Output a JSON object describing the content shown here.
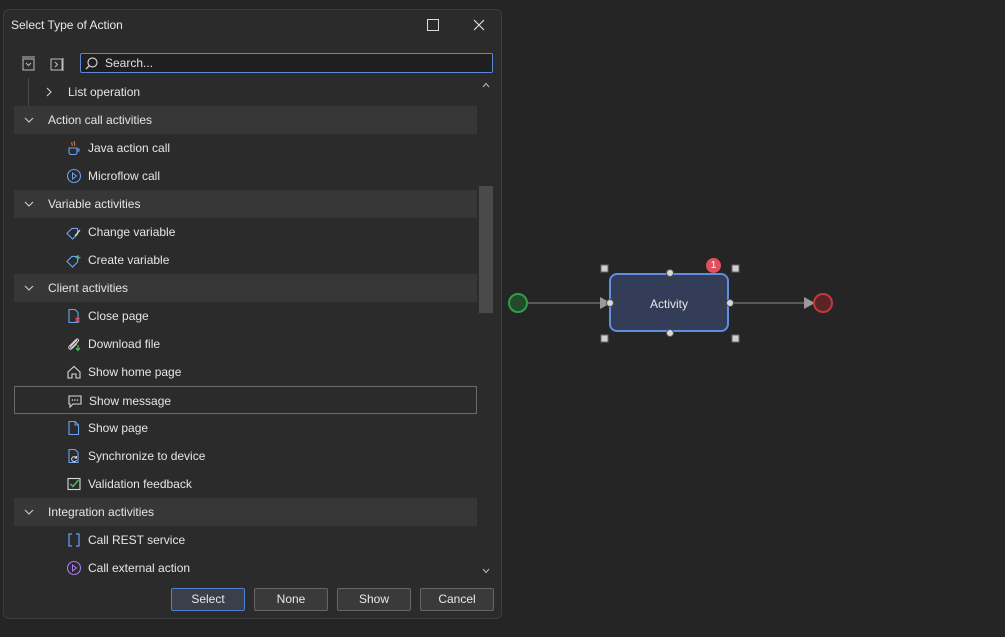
{
  "dialog": {
    "title": "Select Type of Action",
    "search": {
      "placeholder": "Search...",
      "value": ""
    },
    "list": [
      {
        "kind": "sub",
        "label": "List operation",
        "icon": "chevron-right-icon"
      },
      {
        "kind": "category",
        "label": "Action call activities"
      },
      {
        "kind": "item",
        "label": "Java action call",
        "icon": "java-icon"
      },
      {
        "kind": "item",
        "label": "Microflow call",
        "icon": "play-circle-icon"
      },
      {
        "kind": "category",
        "label": "Variable activities"
      },
      {
        "kind": "item",
        "label": "Change variable",
        "icon": "tag-edit-icon"
      },
      {
        "kind": "item",
        "label": "Create variable",
        "icon": "tag-add-icon"
      },
      {
        "kind": "category",
        "label": "Client activities"
      },
      {
        "kind": "item",
        "label": "Close page",
        "icon": "close-page-icon"
      },
      {
        "kind": "item",
        "label": "Download file",
        "icon": "download-file-icon"
      },
      {
        "kind": "item",
        "label": "Show home page",
        "icon": "home-icon"
      },
      {
        "kind": "item",
        "label": "Show message",
        "icon": "message-icon",
        "hover": true
      },
      {
        "kind": "item",
        "label": "Show page",
        "icon": "page-icon"
      },
      {
        "kind": "item",
        "label": "Synchronize to device",
        "icon": "sync-page-icon"
      },
      {
        "kind": "item",
        "label": "Validation feedback",
        "icon": "checkbox-icon"
      },
      {
        "kind": "category",
        "label": "Integration activities"
      },
      {
        "kind": "item",
        "label": "Call REST service",
        "icon": "brackets-icon"
      },
      {
        "kind": "item",
        "label": "Call external action",
        "icon": "play-circle-purple-icon"
      }
    ],
    "buttons": {
      "select": "Select",
      "none": "None",
      "show": "Show",
      "cancel": "Cancel"
    }
  },
  "canvas": {
    "activity_label": "Activity",
    "badge_count": "1",
    "colors": {
      "start": "#2e9e4a",
      "end": "#c0393c",
      "activity_border": "#5e8fe0",
      "activity_fill": "#343d57",
      "badge": "#e0505a"
    }
  }
}
